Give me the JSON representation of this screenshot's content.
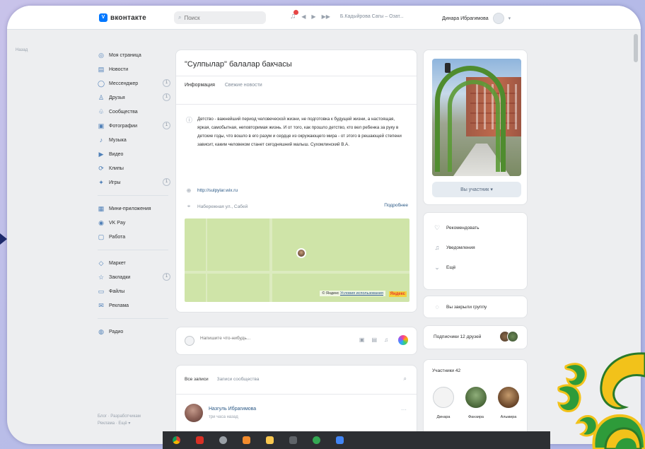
{
  "header": {
    "logo_mark": "V",
    "logo_text": "вконтакте",
    "search_placeholder": "Поиск",
    "player_prev": "◀",
    "player_play": "▶",
    "player_next": "▶▶",
    "track": "Б.Кадыйрова Сагы – Озат...",
    "user_name": "Динара Ибрагимова"
  },
  "side_note": "Назад",
  "nav": {
    "items": [
      {
        "label": "Моя страница",
        "icon": "user-icon"
      },
      {
        "label": "Новости",
        "icon": "news-icon"
      },
      {
        "label": "Мессенджер",
        "icon": "messenger-icon",
        "badge": "1"
      },
      {
        "label": "Друзья",
        "icon": "friends-icon",
        "badge": "1"
      },
      {
        "label": "Сообщества",
        "icon": "communities-icon"
      },
      {
        "label": "Фотографии",
        "icon": "photos-icon",
        "badge": "1"
      },
      {
        "label": "Музыка",
        "icon": "music-icon"
      },
      {
        "label": "Видео",
        "icon": "video-icon"
      },
      {
        "label": "Клипы",
        "icon": "clips-icon"
      },
      {
        "label": "Игры",
        "icon": "games-icon",
        "badge": "1"
      }
    ],
    "items2": [
      {
        "label": "Мини-приложения",
        "icon": "apps-icon"
      },
      {
        "label": "VK Pay",
        "icon": "vkpay-icon"
      },
      {
        "label": "Работа",
        "icon": "work-icon"
      }
    ],
    "items3": [
      {
        "label": "Маркет",
        "icon": "market-icon"
      },
      {
        "label": "Закладки",
        "icon": "bookmarks-icon",
        "badge": "1"
      },
      {
        "label": "Файлы",
        "icon": "files-icon"
      },
      {
        "label": "Реклама",
        "icon": "ads-icon"
      }
    ],
    "items4": [
      {
        "label": "Радио",
        "icon": "radio-icon"
      }
    ],
    "footer_line1": "Блог · Разработчикам",
    "footer_line2": "Реклама · Ещё ▾"
  },
  "group": {
    "title": "\"Сулпылар\" балалар бакчасы",
    "tab_info": "Информация",
    "tab_news": "Свежие новости",
    "description": "Детство - важнейший период человеческой жизни, не подготовка к будущей жизни, а настоящая, яркая, самобытная, неповторимая жизнь. И от того, как прошло детство, кто вел ребенка за руку в детские годы, что вошло в его разум и сердце из окружающего мира - от этого в решающей степени зависит, каким человеком станет сегодняшний малыш. Сухомлинский В.А.",
    "link": "http://sulpylar.wix.ru",
    "address": "Набережная ул., Сабей",
    "more": "Подробнее",
    "map_credit": "© Яндекс",
    "map_terms": "Условия использования",
    "map_brand": "Яндекс"
  },
  "composer": {
    "placeholder": "Напишите что-нибудь..."
  },
  "feed": {
    "tab_all": "Все записи",
    "tab_community": "Записи сообщества",
    "post_author": "Назгуль Ибрагимова",
    "post_time": "три часа назад"
  },
  "right": {
    "join_button": "Вы участник ▾",
    "menu": [
      "Рекомендовать",
      "Уведомления",
      "Ещё"
    ],
    "invite": "Вы закрыли группу",
    "followers": "Подписчики 12 друзей",
    "members_label": "Участники 42",
    "members": [
      "Динара",
      "Фанзира",
      "Альмира"
    ]
  }
}
